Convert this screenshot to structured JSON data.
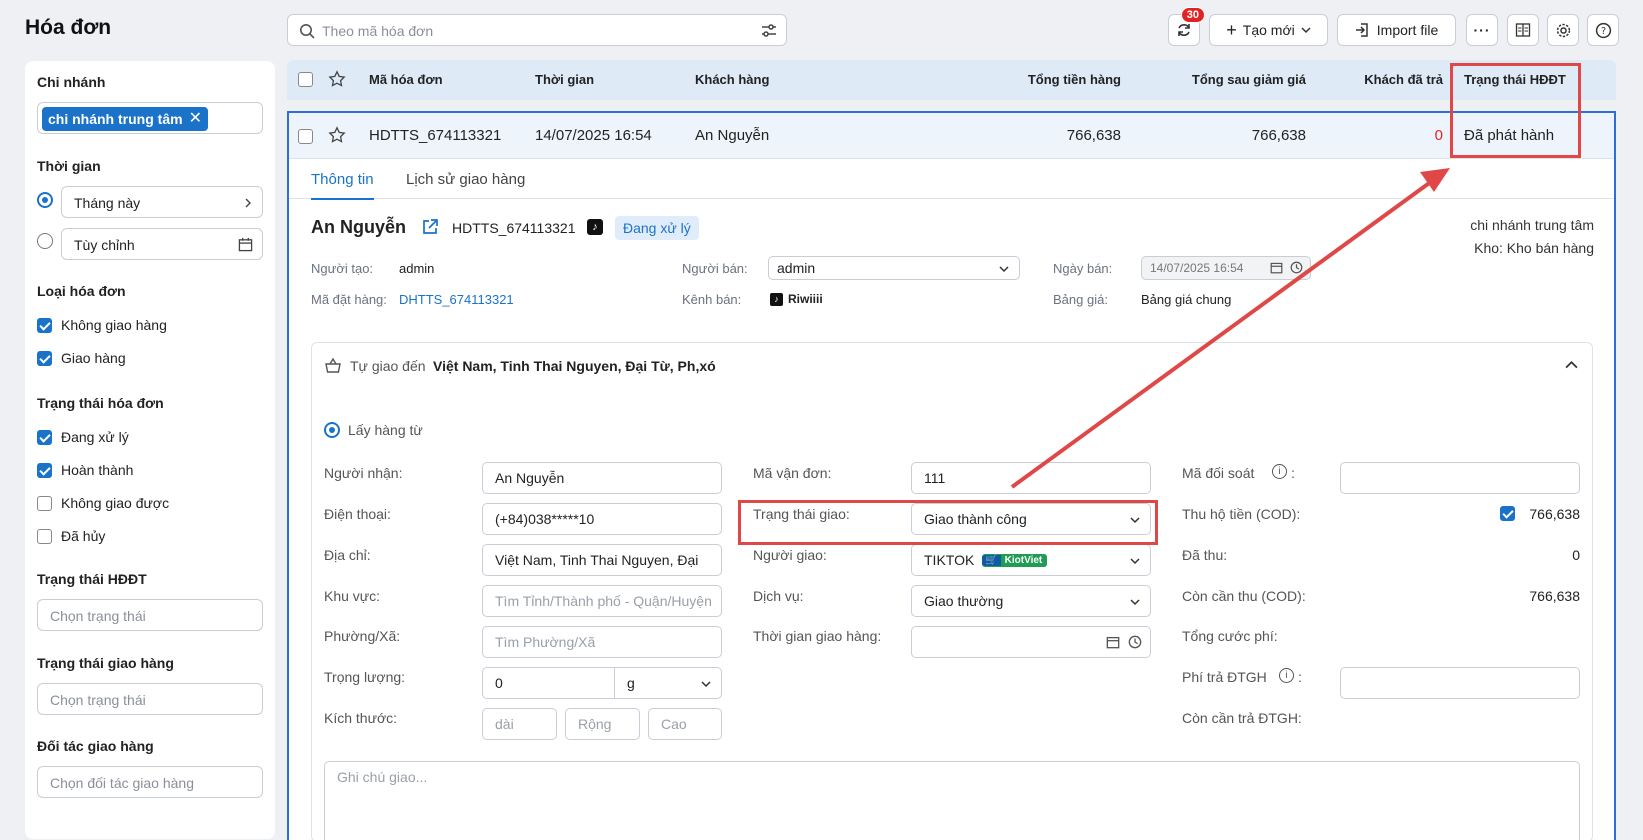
{
  "header": {
    "title": "Hóa đơn",
    "search_placeholder": "Theo mã hóa đơn",
    "sync_badge": "30",
    "create_label": "Tạo mới",
    "import_label": "Import file"
  },
  "sidebar": {
    "branch": {
      "label": "Chi nhánh",
      "chip": "chi nhánh trung tâm"
    },
    "time": {
      "label": "Thời gian",
      "preset": "Tháng này",
      "custom": "Tùy chỉnh"
    },
    "invoice_type": {
      "label": "Loại hóa đơn",
      "items": [
        "Không giao hàng",
        "Giao hàng"
      ]
    },
    "invoice_status": {
      "label": "Trạng thái hóa đơn",
      "items": [
        "Đang xử lý",
        "Hoàn thành",
        "Không giao được",
        "Đã hủy"
      ]
    },
    "einvoice_status": {
      "label": "Trạng thái HĐĐT",
      "placeholder": "Chọn trạng thái"
    },
    "delivery_status": {
      "label": "Trạng thái giao hàng",
      "placeholder": "Chọn trạng thái"
    },
    "delivery_partner": {
      "label": "Đối tác giao hàng",
      "placeholder": "Chọn đối tác giao hàng"
    }
  },
  "table": {
    "columns": [
      "Mã hóa đơn",
      "Thời gian",
      "Khách hàng",
      "Tổng tiền hàng",
      "Tổng sau giảm giá",
      "Khách đã trả",
      "Trạng thái HĐĐT"
    ],
    "row": {
      "code": "HDTTS_674113321",
      "time": "14/07/2025 16:54",
      "customer": "An Nguyễn",
      "total": "766,638",
      "after_discount": "766,638",
      "paid": "0",
      "einvoice_status": "Đã phát hành"
    }
  },
  "detail": {
    "tabs": [
      "Thông tin",
      "Lịch sử giao hàng"
    ],
    "customer": "An Nguyễn",
    "code": "HDTTS_674113321",
    "status": "Đang xử lý",
    "branch": "chi nhánh trung tâm",
    "warehouse": "Kho: Kho bán hàng",
    "creator_label": "Người tạo:",
    "creator": "admin",
    "seller_label": "Người bán:",
    "seller": "admin",
    "sale_date_label": "Ngày bán:",
    "sale_date": "14/07/2025 16:54",
    "order_code_label": "Mã đặt hàng:",
    "order_code": "DHTTS_674113321",
    "channel_label": "Kênh bán:",
    "channel": "Riwiiii",
    "price_list_label": "Bảng giá:",
    "price_list": "Bảng giá chung"
  },
  "shipping": {
    "delivery_prefix": "Tự giao đến",
    "delivery_address": "Việt Nam, Tinh Thai Nguyen, Đại Từ, Ph,xó",
    "pickup_label": "Lấy hàng từ",
    "receiver_label": "Người nhận:",
    "receiver": "An Nguyễn",
    "phone_label": "Điện thoại:",
    "phone": "(+84)038*****10",
    "address_label": "Địa chỉ:",
    "address": "Việt Nam, Tinh Thai Nguyen, Đại",
    "region_label": "Khu vực:",
    "region_placeholder": "Tìm Tỉnh/Thành phố - Quận/Huyện",
    "ward_label": "Phường/Xã:",
    "ward_placeholder": "Tìm Phường/Xã",
    "weight_label": "Trọng lượng:",
    "weight": "0",
    "weight_unit": "g",
    "size_label": "Kích thước:",
    "length_placeholder": "dài",
    "width_placeholder": "Rộng",
    "height_placeholder": "Cao",
    "tracking_label": "Mã vận đơn:",
    "tracking": "111",
    "delivery_status_label": "Trạng thái giao:",
    "delivery_status": "Giao thành công",
    "shipper_label": "Người giao:",
    "shipper": "TIKTOK",
    "shipper_tag": "KiotViet",
    "service_label": "Dịch vụ:",
    "service": "Giao thường",
    "delivery_time_label": "Thời gian giao hàng:",
    "reconcile_label": "Mã đối soát",
    "cod_label": "Thu hộ tiền (COD):",
    "cod": "766,638",
    "collected_label": "Đã thu:",
    "collected": "0",
    "remaining_cod_label": "Còn cần thu (COD):",
    "remaining_cod": "766,638",
    "total_fee_label": "Tổng cước phí:",
    "carrier_fee_label": "Phí trả ĐTGH",
    "remaining_carrier_label": "Còn cần trả ĐTGH:",
    "note_placeholder": "Ghi chú giao..."
  },
  "colors": {
    "accent": "#1a73c8",
    "highlight": "#e04848",
    "header_bg": "#dfeaf7"
  }
}
